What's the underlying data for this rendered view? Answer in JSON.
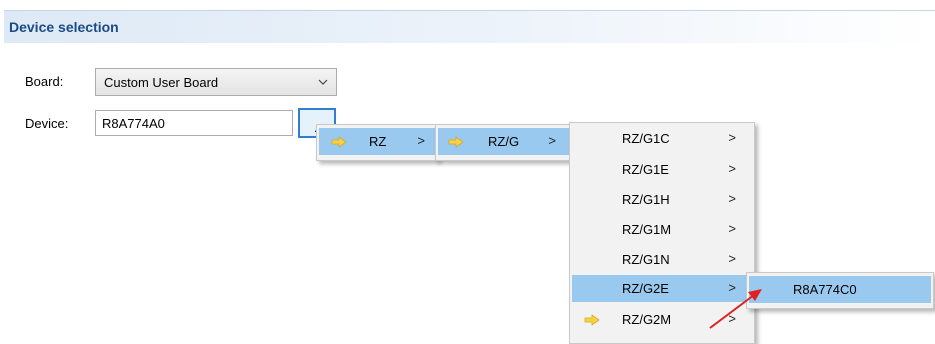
{
  "section": {
    "title": "Device selection"
  },
  "form": {
    "board_label": "Board:",
    "board_value": "Custom User Board",
    "device_label": "Device:",
    "device_value": "R8A774A0",
    "browse_label": ".."
  },
  "menus": {
    "level1": [
      {
        "label": "RZ",
        "submenu": true,
        "icon": "folder-arrow-icon"
      }
    ],
    "level2": [
      {
        "label": "RZ/G",
        "submenu": true,
        "icon": "folder-arrow-icon"
      }
    ],
    "level3": [
      {
        "label": "RZ/G1C",
        "submenu": true
      },
      {
        "label": "RZ/G1E",
        "submenu": true
      },
      {
        "label": "RZ/G1H",
        "submenu": true
      },
      {
        "label": "RZ/G1M",
        "submenu": true
      },
      {
        "label": "RZ/G1N",
        "submenu": true
      },
      {
        "label": "RZ/G2E",
        "submenu": true,
        "highlighted": true
      },
      {
        "label": "RZ/G2M",
        "submenu": true,
        "icon": "folder-arrow-icon"
      }
    ],
    "level4": [
      {
        "label": "R8A774C0",
        "highlighted": true
      }
    ],
    "submenu_glyph": ">"
  },
  "colors": {
    "header_text": "#1c4a85",
    "highlight": "#99c9ef",
    "annotation_arrow": "#e02020",
    "folder_icon": "#f6d24a"
  }
}
